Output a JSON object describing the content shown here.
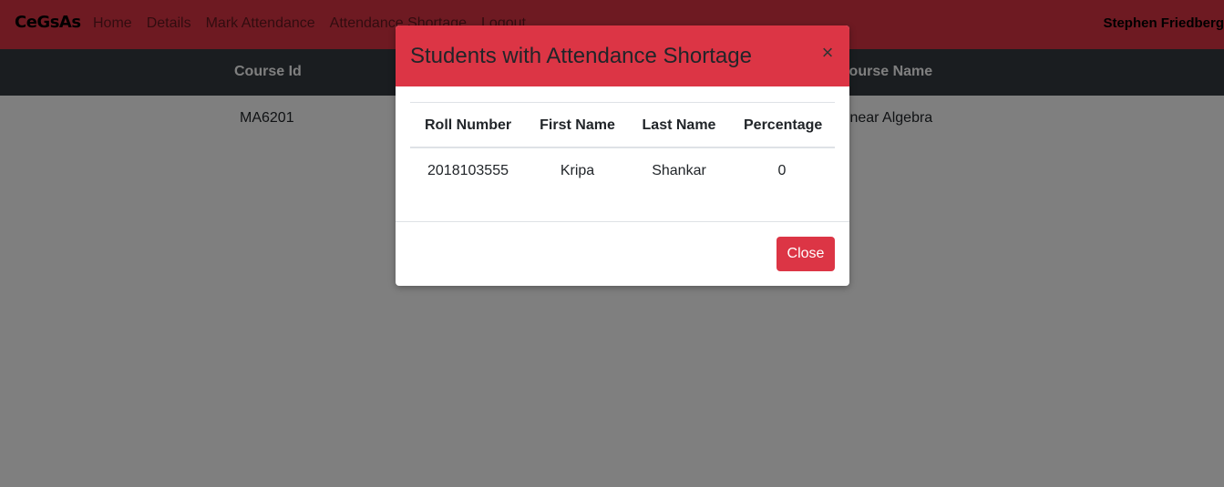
{
  "navbar": {
    "brand": "CeGsAs",
    "links": [
      "Home",
      "Details",
      "Mark Attendance",
      "Attendance Shortage",
      "Logout"
    ],
    "user": "Stephen Friedberg"
  },
  "course_table": {
    "headers": [
      "Course Id",
      "Course Name"
    ],
    "rows": [
      [
        "MA6201",
        "Linear Algebra"
      ]
    ]
  },
  "modal": {
    "title": "Students with Attendance Shortage",
    "close_symbol": "×",
    "headers": [
      "Roll Number",
      "First Name",
      "Last Name",
      "Percentage"
    ],
    "rows": [
      [
        "2018103555",
        "Kripa",
        "Shankar",
        "0"
      ]
    ],
    "close_button": "Close"
  },
  "colors": {
    "navbar": "#dc3545",
    "table_header": "#343a40",
    "backdrop": "rgba(0,0,0,0.5)",
    "button": "#dc3545"
  }
}
